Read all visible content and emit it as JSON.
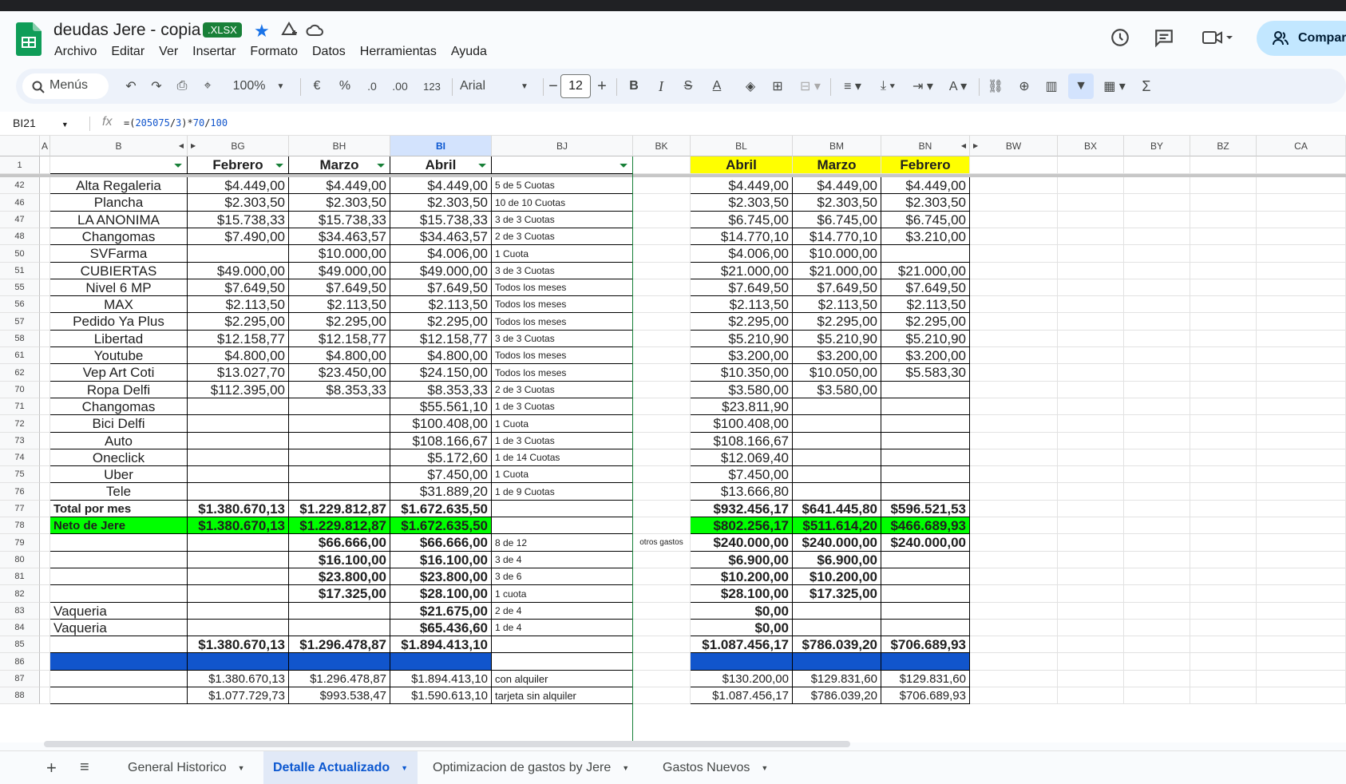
{
  "app": {
    "doc_title": "deudas Jere - copia",
    "badge": ".XLSX",
    "share_label": "Compart",
    "menu": [
      "Archivo",
      "Editar",
      "Ver",
      "Insertar",
      "Formato",
      "Datos",
      "Herramientas",
      "Ayuda"
    ]
  },
  "toolbar": {
    "search": "Menús",
    "zoom": "100%",
    "currency": "€",
    "percent": "%",
    "dec_minus": ".0",
    "dec_plus": ".00",
    "format123": "123",
    "font": "Arial",
    "font_size": "12",
    "bold": "B",
    "italic": "I",
    "sigma": "Σ"
  },
  "formula_bar": {
    "cell_ref": "BI21",
    "fx": "fx",
    "formula_prefix": "=(",
    "formula_num1": "205075",
    "formula_mid1": "/",
    "formula_num2": "3",
    "formula_mid2": ")*",
    "formula_num3": "70",
    "formula_mid3": "/",
    "formula_num4": "100"
  },
  "columns": {
    "A": "A",
    "B": "B",
    "BG": "BG",
    "BH": "BH",
    "BI": "BI",
    "BJ": "BJ",
    "BK": "BK",
    "BL": "BL",
    "BM": "BM",
    "BN": "BN",
    "BW": "BW",
    "BX": "BX",
    "BY": "BY",
    "BZ": "BZ",
    "CA": "CA"
  },
  "header_row": {
    "row": "1",
    "BG": "Febrero",
    "BH": "Marzo",
    "BI": "Abril",
    "BL": "Abril",
    "BM": "Marzo",
    "BN": "Febrero"
  },
  "rows": [
    {
      "n": "42",
      "B": "Alta Regaleria",
      "BG": "$4.449,00",
      "BH": "$4.449,00",
      "BI": "$4.449,00",
      "BJ": "5 de 5 Cuotas",
      "BK": "",
      "BL": "$4.449,00",
      "BM": "$4.449,00",
      "BN": "$4.449,00",
      "style": "normal"
    },
    {
      "n": "46",
      "B": "Plancha",
      "BG": "$2.303,50",
      "BH": "$2.303,50",
      "BI": "$2.303,50",
      "BJ": "10 de 10 Cuotas",
      "BK": "",
      "BL": "$2.303,50",
      "BM": "$2.303,50",
      "BN": "$2.303,50",
      "style": "normal"
    },
    {
      "n": "47",
      "B": "LA ANONIMA",
      "BG": "$15.738,33",
      "BH": "$15.738,33",
      "BI": "$15.738,33",
      "BJ": "3 de 3 Cuotas",
      "BK": "",
      "BL": "$6.745,00",
      "BM": "$6.745,00",
      "BN": "$6.745,00",
      "style": "normal"
    },
    {
      "n": "48",
      "B": "Changomas",
      "BG": "$7.490,00",
      "BH": "$34.463,57",
      "BI": "$34.463,57",
      "BJ": "2 de 3 Cuotas",
      "BK": "",
      "BL": "$14.770,10",
      "BM": "$14.770,10",
      "BN": "$3.210,00",
      "style": "normal"
    },
    {
      "n": "50",
      "B": "SVFarma",
      "BG": "",
      "BH": "$10.000,00",
      "BI": "$4.006,00",
      "BJ": "1 Cuota",
      "BK": "",
      "BL": "$4.006,00",
      "BM": "$10.000,00",
      "BN": "",
      "style": "normal"
    },
    {
      "n": "51",
      "B": "CUBIERTAS",
      "BG": "$49.000,00",
      "BH": "$49.000,00",
      "BI": "$49.000,00",
      "BJ": "3 de 3 Cuotas",
      "BK": "",
      "BL": "$21.000,00",
      "BM": "$21.000,00",
      "BN": "$21.000,00",
      "style": "normal"
    },
    {
      "n": "55",
      "B": "Nivel 6 MP",
      "BG": "$7.649,50",
      "BH": "$7.649,50",
      "BI": "$7.649,50",
      "BJ": "Todos los meses",
      "BK": "",
      "BL": "$7.649,50",
      "BM": "$7.649,50",
      "BN": "$7.649,50",
      "style": "normal"
    },
    {
      "n": "56",
      "B": "MAX",
      "BG": "$2.113,50",
      "BH": "$2.113,50",
      "BI": "$2.113,50",
      "BJ": "Todos los meses",
      "BK": "",
      "BL": "$2.113,50",
      "BM": "$2.113,50",
      "BN": "$2.113,50",
      "style": "normal"
    },
    {
      "n": "57",
      "B": "Pedido Ya Plus",
      "BG": "$2.295,00",
      "BH": "$2.295,00",
      "BI": "$2.295,00",
      "BJ": "Todos los meses",
      "BK": "",
      "BL": "$2.295,00",
      "BM": "$2.295,00",
      "BN": "$2.295,00",
      "style": "normal"
    },
    {
      "n": "58",
      "B": "Libertad",
      "BG": "$12.158,77",
      "BH": "$12.158,77",
      "BI": "$12.158,77",
      "BJ": "3 de 3 Cuotas",
      "BK": "",
      "BL": "$5.210,90",
      "BM": "$5.210,90",
      "BN": "$5.210,90",
      "style": "normal"
    },
    {
      "n": "61",
      "B": "Youtube",
      "BG": "$4.800,00",
      "BH": "$4.800,00",
      "BI": "$4.800,00",
      "BJ": "Todos los meses",
      "BK": "",
      "BL": "$3.200,00",
      "BM": "$3.200,00",
      "BN": "$3.200,00",
      "style": "normal"
    },
    {
      "n": "62",
      "B": "Vep Art Coti",
      "BG": "$13.027,70",
      "BH": "$23.450,00",
      "BI": "$24.150,00",
      "BJ": "Todos los meses",
      "BK": "",
      "BL": "$10.350,00",
      "BM": "$10.050,00",
      "BN": "$5.583,30",
      "style": "normal"
    },
    {
      "n": "70",
      "B": "Ropa Delfi",
      "BG": "$112.395,00",
      "BH": "$8.353,33",
      "BI": "$8.353,33",
      "BJ": "2 de 3 Cuotas",
      "BK": "",
      "BL": "$3.580,00",
      "BM": "$3.580,00",
      "BN": "",
      "style": "normal"
    },
    {
      "n": "71",
      "B": "Changomas",
      "BG": "",
      "BH": "",
      "BI": "$55.561,10",
      "BJ": "1 de 3 Cuotas",
      "BK": "",
      "BL": "$23.811,90",
      "BM": "",
      "BN": "",
      "style": "normal"
    },
    {
      "n": "72",
      "B": "Bici Delfi",
      "BG": "",
      "BH": "",
      "BI": "$100.408,00",
      "BJ": "1 Cuota",
      "BK": "",
      "BL": "$100.408,00",
      "BM": "",
      "BN": "",
      "style": "normal"
    },
    {
      "n": "73",
      "B": "Auto",
      "BG": "",
      "BH": "",
      "BI": "$108.166,67",
      "BJ": "1 de 3 Cuotas",
      "BK": "",
      "BL": "$108.166,67",
      "BM": "",
      "BN": "",
      "style": "normal"
    },
    {
      "n": "74",
      "B": "Oneclick",
      "BG": "",
      "BH": "",
      "BI": "$5.172,60",
      "BJ": "1 de 14 Cuotas",
      "BK": "",
      "BL": "$12.069,40",
      "BM": "",
      "BN": "",
      "style": "normal"
    },
    {
      "n": "75",
      "B": "Uber",
      "BG": "",
      "BH": "",
      "BI": "$7.450,00",
      "BJ": "1 Cuota",
      "BK": "",
      "BL": "$7.450,00",
      "BM": "",
      "BN": "",
      "style": "normal"
    },
    {
      "n": "76",
      "B": "Tele",
      "BG": "",
      "BH": "",
      "BI": "$31.889,20",
      "BJ": "1 de 9 Cuotas",
      "BK": "",
      "BL": "$13.666,80",
      "BM": "",
      "BN": "",
      "style": "normal"
    },
    {
      "n": "77",
      "B": "Total por mes",
      "BG": "$1.380.670,13",
      "BH": "$1.229.812,87",
      "BI": "$1.672.635,50",
      "BJ": "",
      "BK": "",
      "BL": "$932.456,17",
      "BM": "$641.445,80",
      "BN": "$596.521,53",
      "style": "total"
    },
    {
      "n": "78",
      "B": "Neto de Jere",
      "BG": "$1.380.670,13",
      "BH": "$1.229.812,87",
      "BI": "$1.672.635,50",
      "BJ": "",
      "BK": "",
      "BL": "$802.256,17",
      "BM": "$511.614,20",
      "BN": "$466.689,93",
      "style": "green"
    },
    {
      "n": "79",
      "B": "",
      "BG": "",
      "BH": "$66.666,00",
      "BI": "$66.666,00",
      "BJ": "8 de 12",
      "BK": "otros gastos",
      "BL": "$240.000,00",
      "BM": "$240.000,00",
      "BN": "$240.000,00",
      "style": "boldvals"
    },
    {
      "n": "80",
      "B": "",
      "BG": "",
      "BH": "$16.100,00",
      "BI": "$16.100,00",
      "BJ": "3 de 4",
      "BK": "",
      "BL": "$6.900,00",
      "BM": "$6.900,00",
      "BN": "",
      "style": "boldvals"
    },
    {
      "n": "81",
      "B": "",
      "BG": "",
      "BH": "$23.800,00",
      "BI": "$23.800,00",
      "BJ": "3 de 6",
      "BK": "",
      "BL": "$10.200,00",
      "BM": "$10.200,00",
      "BN": "",
      "style": "boldvals"
    },
    {
      "n": "82",
      "B": "",
      "BG": "",
      "BH": "$17.325,00",
      "BI": "$28.100,00",
      "BJ": "1 cuota",
      "BK": "",
      "BL": "$28.100,00",
      "BM": "$17.325,00",
      "BN": "",
      "style": "boldvals"
    },
    {
      "n": "83",
      "B": "Vaqueria",
      "BG": "",
      "BH": "",
      "BI": "$21.675,00",
      "BJ": "2 de 4",
      "BK": "",
      "BL": "$0,00",
      "BM": "",
      "BN": "",
      "style": "boldvals"
    },
    {
      "n": "84",
      "B": "Vaqueria",
      "BG": "",
      "BH": "",
      "BI": "$65.436,60",
      "BJ": "1 de 4",
      "BK": "",
      "BL": "$0,00",
      "BM": "",
      "BN": "",
      "style": "boldvals"
    },
    {
      "n": "85",
      "B": "",
      "BG": "$1.380.670,13",
      "BH": "$1.296.478,87",
      "BI": "$1.894.413,10",
      "BJ": "",
      "BK": "",
      "BL": "$1.087.456,17",
      "BM": "$786.039,20",
      "BN": "$706.689,93",
      "style": "boldvals"
    },
    {
      "n": "86",
      "B": "",
      "BG": "",
      "BH": "",
      "BI": "",
      "BJ": "",
      "BK": "",
      "BL": "",
      "BM": "",
      "BN": "",
      "style": "blue"
    },
    {
      "n": "87",
      "B": "",
      "BG": "$1.380.670,13",
      "BH": "$1.296.478,87",
      "BI": "$1.894.413,10",
      "BJ": "con alquiler",
      "BK": "",
      "BL": "$130.200,00",
      "BM": "$129.831,60",
      "BN": "$129.831,60",
      "style": "plain"
    },
    {
      "n": "88",
      "B": "",
      "BG": "$1.077.729,73",
      "BH": "$993.538,47",
      "BI": "$1.590.613,10",
      "BJ": "tarjeta sin alquiler",
      "BK": "",
      "BL": "$1.087.456,17",
      "BM": "$786.039,20",
      "BN": "$706.689,93",
      "style": "plain"
    }
  ],
  "sheet_tabs": [
    "General Historico",
    "Detalle Actualizado",
    "Optimizacion de gastos by Jere",
    "Gastos Nuevos"
  ],
  "colors": {
    "yellow": "#ffff00",
    "green": "#00ff00",
    "blue": "#1155cc",
    "accent": "#0b57d0"
  }
}
